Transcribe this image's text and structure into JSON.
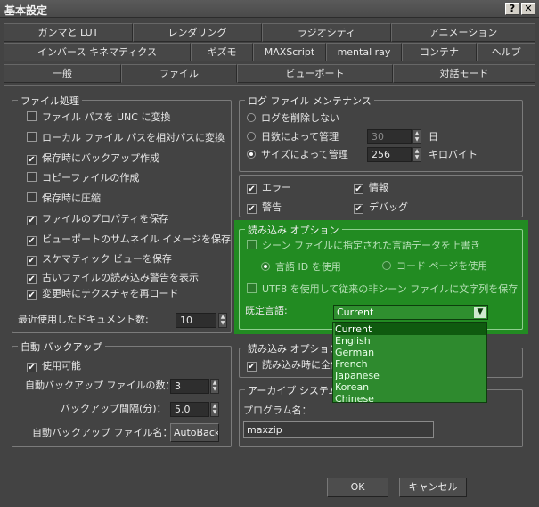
{
  "window": {
    "title": "基本設定",
    "help_label": "?",
    "close_label": "✕"
  },
  "tabs": {
    "row1": [
      "ガンマと LUT",
      "レンダリング",
      "ラジオシティ",
      "アニメーション"
    ],
    "row2": [
      "インバース キネマティクス",
      "ギズモ",
      "MAXScript",
      "mental ray",
      "コンテナ",
      "ヘルプ"
    ],
    "row3": [
      "一般",
      "ファイル",
      "ビューポート",
      "対話モード"
    ],
    "active": "ファイル"
  },
  "file_handling": {
    "title": "ファイル処理",
    "items": [
      {
        "label": "ファイル パスを UNC に変換",
        "checked": false
      },
      {
        "label": "ローカル ファイル パスを相対パスに変換",
        "checked": false
      },
      {
        "label": "保存時にバックアップ作成",
        "checked": true
      },
      {
        "label": "コピーファイルの作成",
        "checked": false
      },
      {
        "label": "保存時に圧縮",
        "checked": false
      },
      {
        "label": "ファイルのプロパティを保存",
        "checked": true
      },
      {
        "label": "ビューポートのサムネイル イメージを保存",
        "checked": true
      },
      {
        "label": "スケマティック ビューを保存",
        "checked": true
      },
      {
        "label": "古いファイルの読み込み警告を表示",
        "checked": true
      },
      {
        "label": "変更時にテクスチャを再ロード",
        "checked": true
      }
    ],
    "recent_docs_label": "最近使用したドキュメント数:",
    "recent_docs_value": "10"
  },
  "log_maintenance": {
    "title": "ログ ファイル メンテナンス",
    "options": [
      {
        "label": "ログを削除しない",
        "selected": false
      },
      {
        "label": "日数によって管理",
        "selected": false,
        "value": "30",
        "unit": "日"
      },
      {
        "label": "サイズによって管理",
        "selected": true,
        "value": "256",
        "unit": "キロバイト"
      }
    ],
    "flags": [
      {
        "label": "エラー",
        "checked": true
      },
      {
        "label": "情報",
        "checked": true
      },
      {
        "label": "警告",
        "checked": true
      },
      {
        "label": "デバッグ",
        "checked": true
      }
    ]
  },
  "load_options": {
    "title": "読み込み オプション",
    "use_scene_lang": "シーン ファイルに指定された言語データを上書き",
    "radio_lang_id": "言語 ID を使用",
    "radio_code_page": "コード ページを使用",
    "utf8": "UTF8 を使用して従来の非シーン ファイルに文字列を保存",
    "default_lang_label": "既定言語:",
    "default_lang_value": "Current",
    "dropdown_options": [
      "Current",
      "English",
      "German",
      "French",
      "Japanese",
      "Korean",
      "Chinese"
    ]
  },
  "auto_backup": {
    "title": "自動 バックアップ",
    "enabled_label": "使用可能",
    "enabled": true,
    "count_label": "自動バックアップ ファイルの数：",
    "count_value": "3",
    "interval_label": "バックアップ間隔(分)：",
    "interval_value": "5.0",
    "name_label": "自動バックアップ ファイル名：",
    "name_value": "AutoBackup"
  },
  "load_options2": {
    "title": "読み込み オプション",
    "checkbox_label": "読み込み時に全体",
    "checked": true
  },
  "archive": {
    "title": "アーカイブ システム",
    "program_label": "プログラム名：",
    "program_value": "maxzip"
  },
  "buttons": {
    "ok": "OK",
    "cancel": "キャンセル"
  },
  "colors": {
    "highlight": "#228b22",
    "background": "#434343"
  }
}
